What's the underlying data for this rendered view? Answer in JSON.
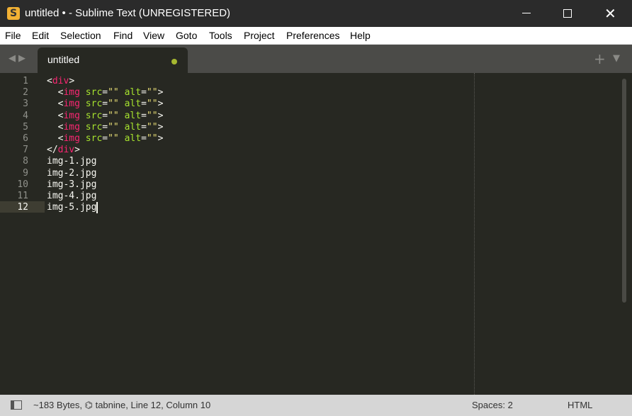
{
  "window": {
    "title": "untitled • - Sublime Text (UNREGISTERED)",
    "app_icon": "sublime-text-icon",
    "controls": {
      "minimize": "minimize-icon",
      "maximize": "maximize-icon",
      "close": "close-icon"
    }
  },
  "menu": [
    {
      "label": "File"
    },
    {
      "label": "Edit"
    },
    {
      "label": "Selection"
    },
    {
      "label": "Find"
    },
    {
      "label": "View"
    },
    {
      "label": "Goto"
    },
    {
      "label": "Tools"
    },
    {
      "label": "Project"
    },
    {
      "label": "Preferences"
    },
    {
      "label": "Help"
    }
  ],
  "tabs": [
    {
      "label": "untitled",
      "dirty": true,
      "active": true
    }
  ],
  "tabbar_icons": {
    "nav": "nav-arrows-icon",
    "new_tab": "plus-icon",
    "tab_menu": "dropdown-icon"
  },
  "editor": {
    "current_line": 12,
    "line_numbers": [
      "1",
      "2",
      "3",
      "4",
      "5",
      "6",
      "7",
      "8",
      "9",
      "10",
      "11",
      "12"
    ],
    "lines": [
      {
        "indent": "",
        "parts": [
          {
            "t": "<",
            "c": "plain"
          },
          {
            "t": "div",
            "c": "tag"
          },
          {
            "t": ">",
            "c": "plain"
          }
        ]
      },
      {
        "indent": "  ",
        "parts": [
          {
            "t": "<",
            "c": "plain"
          },
          {
            "t": "img",
            "c": "tag"
          },
          {
            "t": " ",
            "c": "plain"
          },
          {
            "t": "src",
            "c": "attr"
          },
          {
            "t": "=",
            "c": "plain"
          },
          {
            "t": "\"\"",
            "c": "str"
          },
          {
            "t": " ",
            "c": "plain"
          },
          {
            "t": "alt",
            "c": "attr"
          },
          {
            "t": "=",
            "c": "plain"
          },
          {
            "t": "\"\"",
            "c": "str"
          },
          {
            "t": ">",
            "c": "plain"
          }
        ]
      },
      {
        "indent": "  ",
        "parts": [
          {
            "t": "<",
            "c": "plain"
          },
          {
            "t": "img",
            "c": "tag"
          },
          {
            "t": " ",
            "c": "plain"
          },
          {
            "t": "src",
            "c": "attr"
          },
          {
            "t": "=",
            "c": "plain"
          },
          {
            "t": "\"\"",
            "c": "str"
          },
          {
            "t": " ",
            "c": "plain"
          },
          {
            "t": "alt",
            "c": "attr"
          },
          {
            "t": "=",
            "c": "plain"
          },
          {
            "t": "\"\"",
            "c": "str"
          },
          {
            "t": ">",
            "c": "plain"
          }
        ]
      },
      {
        "indent": "  ",
        "parts": [
          {
            "t": "<",
            "c": "plain"
          },
          {
            "t": "img",
            "c": "tag"
          },
          {
            "t": " ",
            "c": "plain"
          },
          {
            "t": "src",
            "c": "attr"
          },
          {
            "t": "=",
            "c": "plain"
          },
          {
            "t": "\"\"",
            "c": "str"
          },
          {
            "t": " ",
            "c": "plain"
          },
          {
            "t": "alt",
            "c": "attr"
          },
          {
            "t": "=",
            "c": "plain"
          },
          {
            "t": "\"\"",
            "c": "str"
          },
          {
            "t": ">",
            "c": "plain"
          }
        ]
      },
      {
        "indent": "  ",
        "parts": [
          {
            "t": "<",
            "c": "plain"
          },
          {
            "t": "img",
            "c": "tag"
          },
          {
            "t": " ",
            "c": "plain"
          },
          {
            "t": "src",
            "c": "attr"
          },
          {
            "t": "=",
            "c": "plain"
          },
          {
            "t": "\"\"",
            "c": "str"
          },
          {
            "t": " ",
            "c": "plain"
          },
          {
            "t": "alt",
            "c": "attr"
          },
          {
            "t": "=",
            "c": "plain"
          },
          {
            "t": "\"\"",
            "c": "str"
          },
          {
            "t": ">",
            "c": "plain"
          }
        ]
      },
      {
        "indent": "  ",
        "parts": [
          {
            "t": "<",
            "c": "plain"
          },
          {
            "t": "img",
            "c": "tag"
          },
          {
            "t": " ",
            "c": "plain"
          },
          {
            "t": "src",
            "c": "attr"
          },
          {
            "t": "=",
            "c": "plain"
          },
          {
            "t": "\"\"",
            "c": "str"
          },
          {
            "t": " ",
            "c": "plain"
          },
          {
            "t": "alt",
            "c": "attr"
          },
          {
            "t": "=",
            "c": "plain"
          },
          {
            "t": "\"\"",
            "c": "str"
          },
          {
            "t": ">",
            "c": "plain"
          }
        ]
      },
      {
        "indent": "",
        "parts": [
          {
            "t": "</",
            "c": "plain"
          },
          {
            "t": "div",
            "c": "tag"
          },
          {
            "t": ">",
            "c": "plain"
          }
        ]
      },
      {
        "indent": "",
        "parts": [
          {
            "t": "img-1.jpg",
            "c": "plain"
          }
        ]
      },
      {
        "indent": "",
        "parts": [
          {
            "t": "img-2.jpg",
            "c": "plain"
          }
        ]
      },
      {
        "indent": "",
        "parts": [
          {
            "t": "img-3.jpg",
            "c": "plain"
          }
        ]
      },
      {
        "indent": "",
        "parts": [
          {
            "t": "img-4.jpg",
            "c": "plain"
          }
        ]
      },
      {
        "indent": "",
        "parts": [
          {
            "t": "img-5.jpg",
            "c": "plain"
          }
        ]
      }
    ]
  },
  "status": {
    "panel_icon": "show-panel-icon",
    "info": "~183 Bytes, ⌬ tabnine, Line 12, Column 10",
    "indentation": "Spaces: 2",
    "syntax": "HTML"
  },
  "colors": {
    "editor_bg": "#272822",
    "tag": "#f92672",
    "attribute": "#a6e22e",
    "string": "#e6db74",
    "dirty_dot": "#a6b830"
  }
}
